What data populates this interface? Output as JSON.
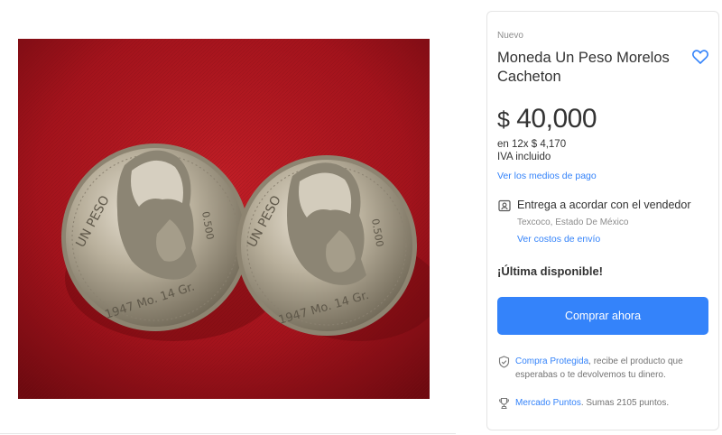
{
  "product": {
    "condition": "Nuevo",
    "title": "Moneda Un Peso Morelos Cacheton",
    "image_alt": "Dos monedas de un peso Morelos 1947 sobre fondo rojo",
    "coin_legend_left": "UN PESO  1947  Mo. 14 Gr.",
    "coin_legend_right": "UN PESO  1947  Mo. 14 Gr."
  },
  "price": {
    "currency": "$",
    "amount": "40,000",
    "installments": "en 12x $ 4,170",
    "tax_note": "IVA incluido",
    "payment_link": "Ver los medios de pago"
  },
  "shipping": {
    "title": "Entrega a acordar con el vendedor",
    "location": "Texcoco, Estado De México",
    "costs_link": "Ver costos de envío"
  },
  "stock": {
    "label": "¡Última disponible!"
  },
  "buy": {
    "button_label": "Comprar ahora"
  },
  "protection": {
    "link": "Compra Protegida",
    "text": ", recibe el producto que esperabas o te devolvemos tu dinero."
  },
  "points": {
    "link": "Mercado Puntos",
    "text": ". Sumas 2105 puntos."
  },
  "icons": {
    "favorite": "heart-outline-icon",
    "shipping": "map-pin-box-icon",
    "protection": "shield-check-icon",
    "points": "trophy-icon"
  },
  "colors": {
    "accent": "#3483fa",
    "background_photo": "#a3131c"
  }
}
